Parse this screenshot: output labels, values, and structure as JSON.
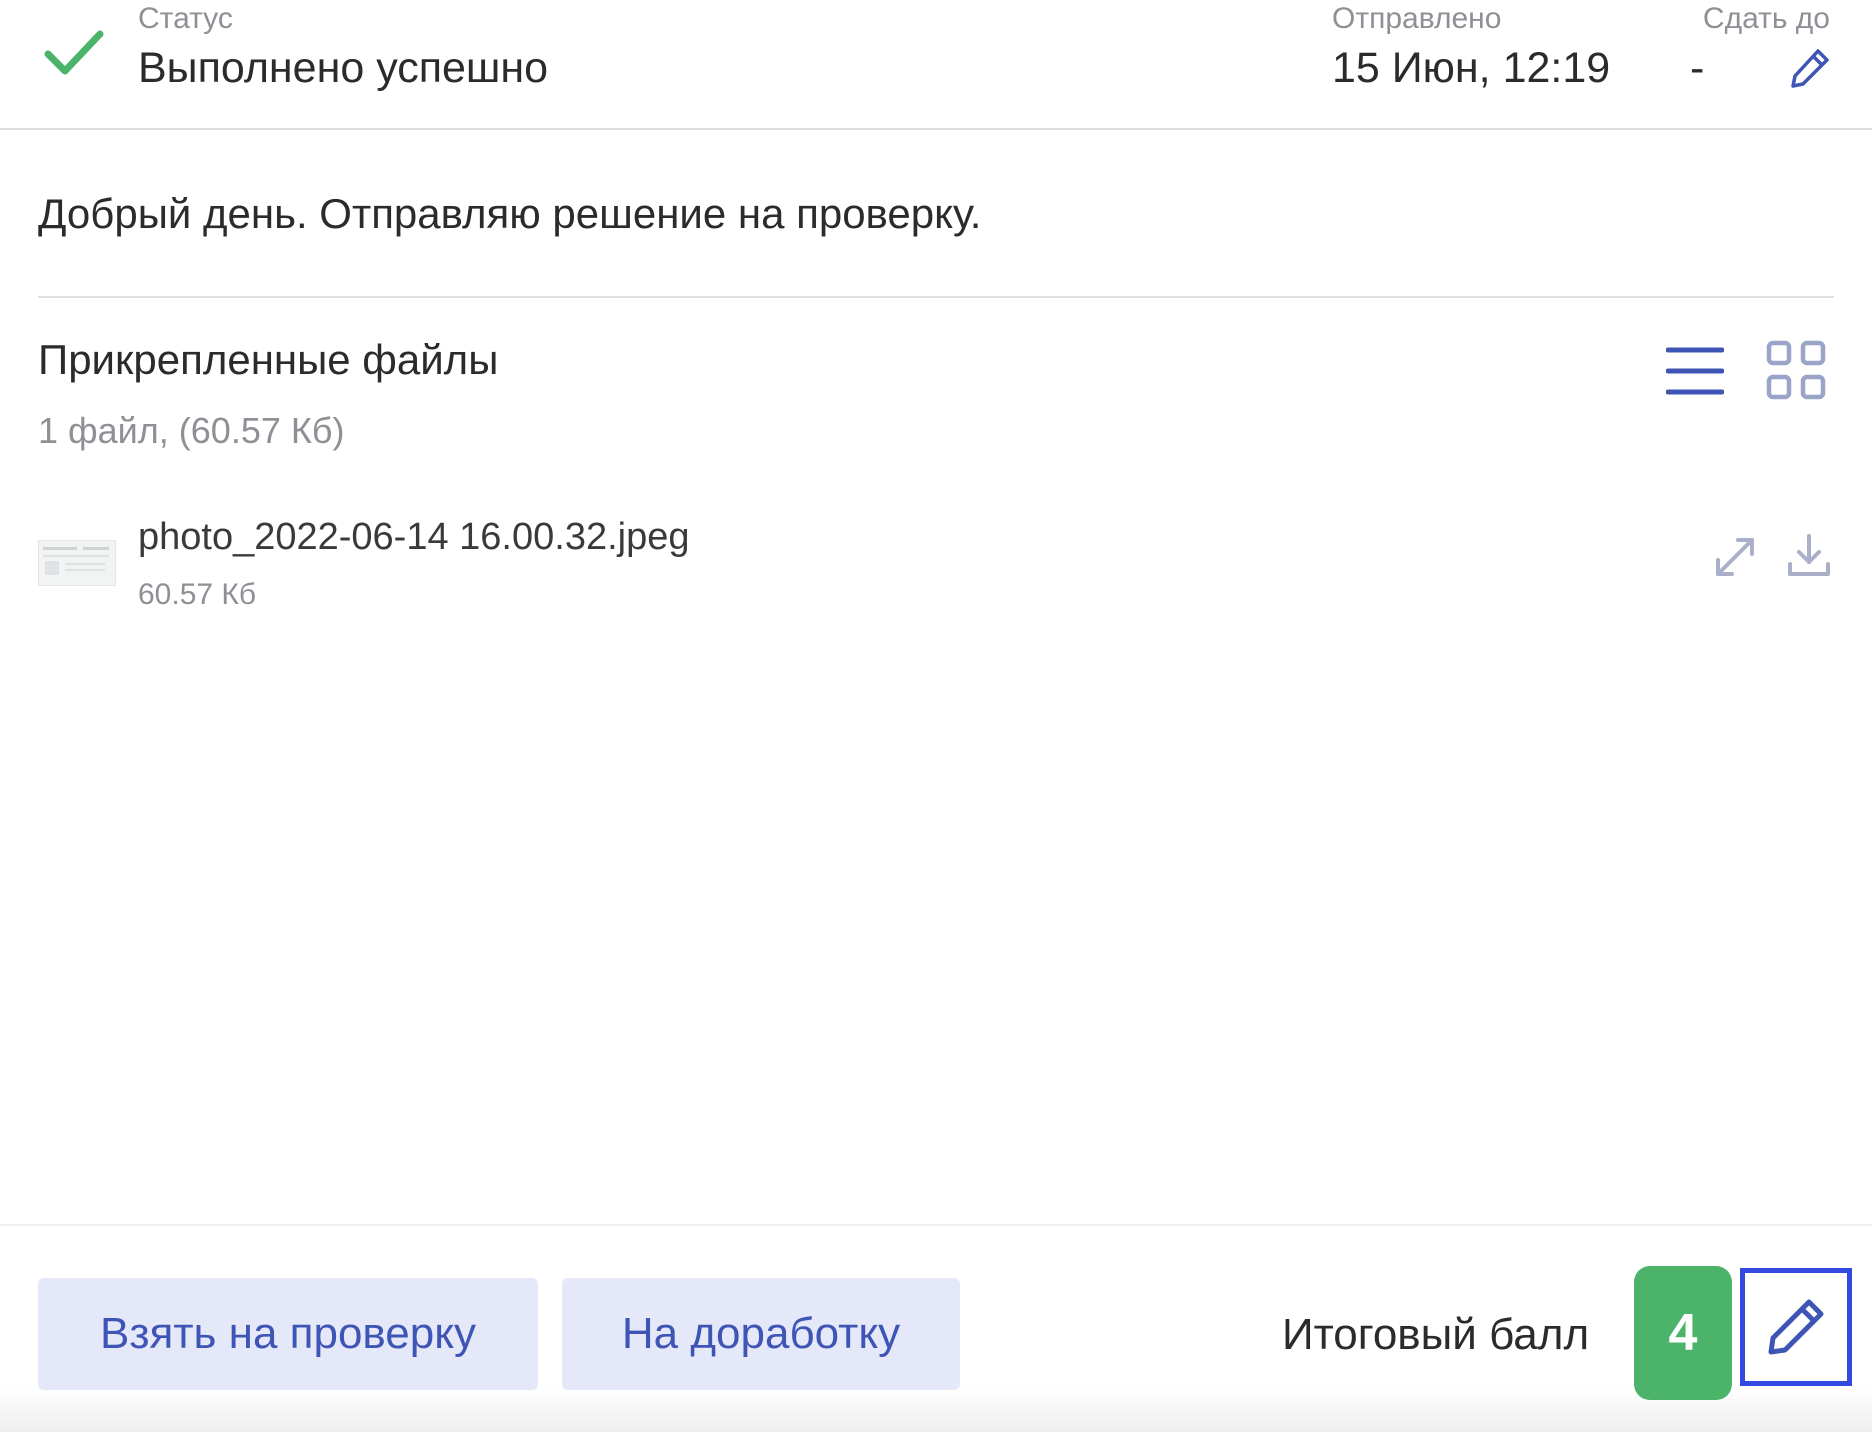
{
  "header": {
    "status_label": "Статус",
    "status_value": "Выполнено успешно",
    "sent_label": "Отправлено",
    "sent_value": "15 Июн, 12:19",
    "due_label": "Сдать до",
    "due_value": "-"
  },
  "message": "Добрый день. Отправляю решение на проверку.",
  "files": {
    "title": "Прикрепленные файлы",
    "summary": "1 файл, (60.57 Кб)",
    "items": [
      {
        "name": "photo_2022-06-14 16.00.32.jpeg",
        "size": "60.57 Кб"
      }
    ]
  },
  "footer": {
    "take_review_label": "Взять на проверку",
    "rework_label": "На доработку",
    "score_label": "Итоговый балл",
    "score_value": "4"
  },
  "colors": {
    "success": "#4cb46a",
    "accent": "#3f55b5",
    "button_bg": "#e4e8f8",
    "focus_outline": "#3349e0",
    "muted_text": "#8f8f96"
  },
  "icons": [
    "check-icon",
    "pencil-icon",
    "list-view-icon",
    "grid-view-icon",
    "expand-icon",
    "download-icon"
  ]
}
